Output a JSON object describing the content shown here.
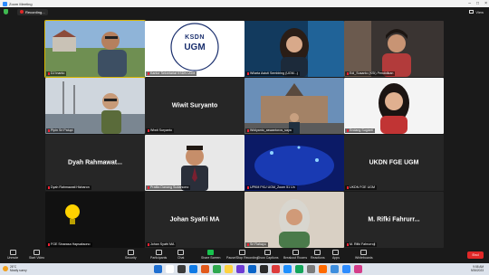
{
  "titlebar": {
    "title": "Zoom Meeting"
  },
  "topbar": {
    "recording_label": "Recording...",
    "view_label": "View"
  },
  "tiles": [
    {
      "kind": "video",
      "scene": "outdoor",
      "label": "DJ Inanto",
      "active": true
    },
    {
      "kind": "video",
      "scene": "logo",
      "label": "Kantor Sekretariat KSDN UGM",
      "logo_top": "KSDN",
      "logo_bottom": "UGM"
    },
    {
      "kind": "video",
      "scene": "woman",
      "label": "Wilarta Astuti Sembiring (UGM...)"
    },
    {
      "kind": "video",
      "scene": "youngman",
      "label": "Edi_Susanto (KSI) Pendidikan"
    },
    {
      "kind": "video",
      "scene": "harbor",
      "label": "Pipin Sri Palupi"
    },
    {
      "kind": "name",
      "name": "Wiwit Suryanto",
      "label": "Wiwit Suryanto"
    },
    {
      "kind": "video",
      "scene": "palace",
      "label": "Widiyanto_aswantoros_saya"
    },
    {
      "kind": "video",
      "scene": "woman2",
      "label": "Endang Sugiarti"
    },
    {
      "kind": "name",
      "name": "Dyah Rahmawat...",
      "label": "Dyah Rahmawati Hizbaron"
    },
    {
      "kind": "video",
      "scene": "man3",
      "label": "Pratita Danang Sudarsono"
    },
    {
      "kind": "video",
      "scene": "aquarium",
      "label": "UPKM FKU UGM_Zoom 51 Un"
    },
    {
      "kind": "name",
      "name": "UKDN FGE UGM",
      "label": "UKDN FGE UGM"
    },
    {
      "kind": "video",
      "scene": "bulb",
      "label": "FGE Sinarasa Hapsaksono"
    },
    {
      "kind": "name",
      "name": "Johan Syafri MA",
      "label": "Johan Syafri MA"
    },
    {
      "kind": "video",
      "scene": "hijab",
      "label": "Sri Rahayu"
    },
    {
      "kind": "name",
      "name": "M. Rifki Fahrurr...",
      "label": "M. Rifki Fahrurroji"
    }
  ],
  "toolbar": {
    "items": [
      {
        "label": "Unmute",
        "icon": "mic-icon"
      },
      {
        "label": "Start Video",
        "icon": "camera-icon"
      },
      {
        "label": "Security",
        "icon": "shield-icon"
      },
      {
        "label": "Participants",
        "icon": "people-icon"
      },
      {
        "label": "Chat",
        "icon": "chat-icon"
      },
      {
        "label": "Share Screen",
        "icon": "share-icon"
      },
      {
        "label": "Pause/Stop Recording",
        "icon": "record-icon"
      },
      {
        "label": "Show Captions",
        "icon": "cc-icon"
      },
      {
        "label": "Breakout Rooms",
        "icon": "rooms-icon"
      },
      {
        "label": "Reactions",
        "icon": "smile-icon"
      },
      {
        "label": "Apps",
        "icon": "apps-icon"
      },
      {
        "label": "Whiteboards",
        "icon": "whiteboard-icon"
      }
    ],
    "end_label": "End"
  },
  "taskbar": {
    "temp": "26°C",
    "weather": "Mostly sunny",
    "time": "9:58 AM",
    "date": "9/26/2023",
    "app_colors": [
      "#1f6fd1",
      "#ffffff",
      "#3b3b3b",
      "#0f7ae5",
      "#e25a1c",
      "#2fa84f",
      "#ffd23f",
      "#6e3bd4",
      "#0a64c8",
      "#2b2b2b",
      "#de3c3c",
      "#1e90ff",
      "#14a55a",
      "#7b7b7b",
      "#ff6a00",
      "#3e8ede",
      "#2d8cff",
      "#d43d8a"
    ]
  }
}
